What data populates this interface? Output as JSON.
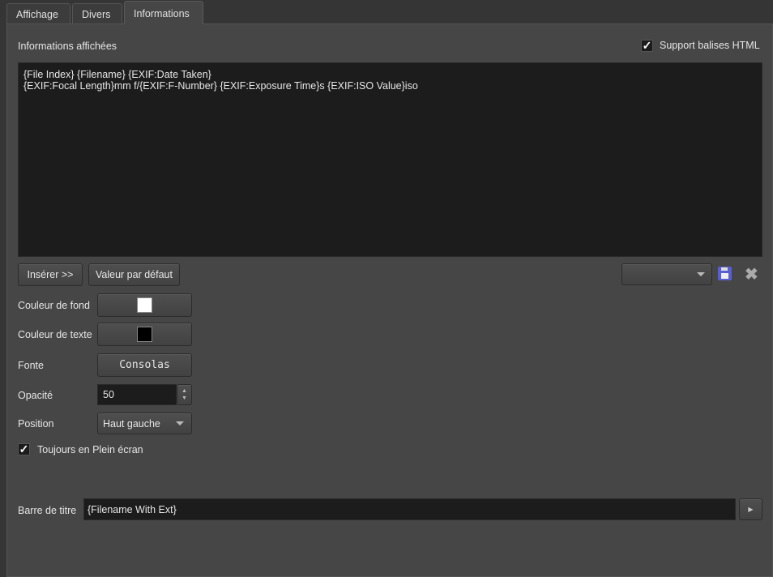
{
  "tabs": [
    {
      "label": "Affichage"
    },
    {
      "label": "Divers"
    },
    {
      "label": "Informations"
    }
  ],
  "info": {
    "label": "Informations affichées",
    "html_support_label": "Support balises HTML",
    "html_support_checked": true,
    "text_line1": "{File Index} {Filename} {EXIF:Date Taken}",
    "text_line2": "{EXIF:Focal Length}mm f/{EXIF:F-Number} {EXIF:Exposure Time}s {EXIF:ISO Value}iso"
  },
  "buttons": {
    "insert": "Insérer >>",
    "default": "Valeur par défaut"
  },
  "preset": {
    "value": ""
  },
  "colors": {
    "background": "#ffffff",
    "text": "#000000"
  },
  "form": {
    "bg_color_label": "Couleur de fond",
    "text_color_label": "Couleur de texte",
    "font_label": "Fonte",
    "font_value": "Consolas",
    "opacity_label": "Opacité",
    "opacity_value": "50",
    "position_label": "Position",
    "position_value": "Haut gauche",
    "fullscreen_label": "Toujours en Plein écran",
    "fullscreen_checked": true
  },
  "titlebar": {
    "label": "Barre de titre",
    "value": "{Filename With Ext}"
  }
}
